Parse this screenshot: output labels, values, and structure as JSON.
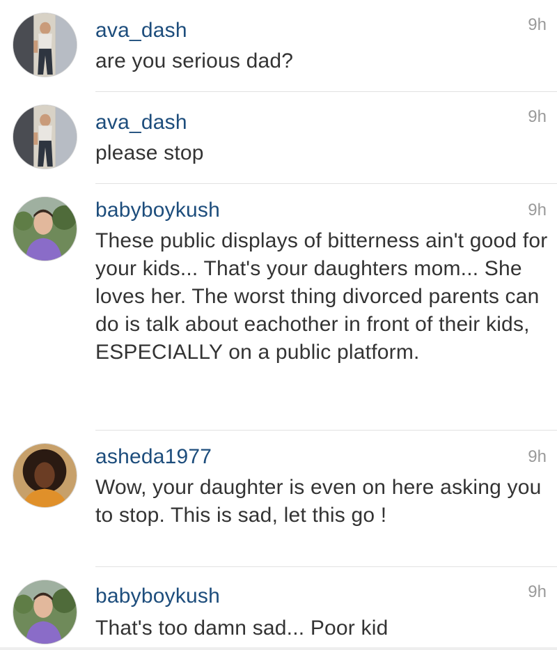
{
  "comments": [
    {
      "username": "ava_dash",
      "time": "9h",
      "text": "are you serious dad?",
      "avatar_icon": "avatar-photo-woman-mirror"
    },
    {
      "username": "ava_dash",
      "time": "9h",
      "text": "please stop",
      "avatar_icon": "avatar-photo-woman-mirror"
    },
    {
      "username": "babyboykush",
      "time": "9h",
      "text": "These public displays of bitterness ain't good for your kids... That's your daughters mom... She loves her. The worst thing divorced parents can do is talk about eachother in front of their kids, ESPECIALLY on a public platform.",
      "avatar_icon": "avatar-photo-man-outdoor"
    },
    {
      "username": "asheda1977",
      "time": "9h",
      "text": "Wow, your daughter is even on here asking you to stop. This is sad, let this go !",
      "avatar_icon": "avatar-photo-woman-curly-hair"
    },
    {
      "username": "babyboykush",
      "time": "9h",
      "text": "That's too damn sad... Poor kid",
      "avatar_icon": "avatar-photo-man-outdoor"
    }
  ],
  "colors": {
    "username": "#1d4d7c",
    "text": "#333333",
    "timestamp": "#9a9a9a",
    "divider": "#e2e2e2"
  }
}
